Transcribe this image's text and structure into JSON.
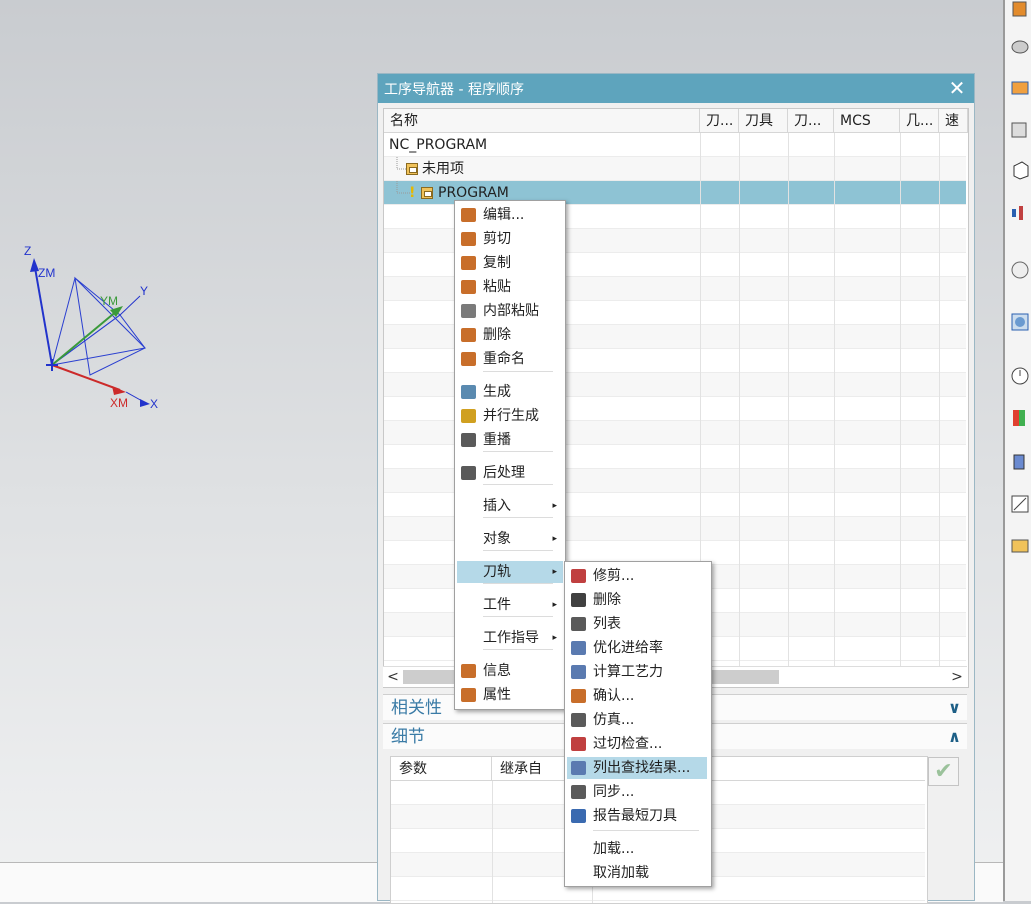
{
  "dialog": {
    "title": "工序导航器 - 程序顺序",
    "close_glyph": "✕"
  },
  "grid": {
    "columns": [
      "名称",
      "刀...",
      "刀具",
      "刀...",
      "MCS",
      "几...",
      "速"
    ],
    "nodes": {
      "root": "NC_PROGRAM",
      "unused": "未用项",
      "program": "PROGRAM",
      "warning": "!"
    }
  },
  "scroll": {
    "left": "<",
    "right": ">"
  },
  "sections": {
    "relevance": {
      "label": "相关性",
      "chevron": "∨"
    },
    "details": {
      "label": "细节",
      "chevron": "∧"
    }
  },
  "params": {
    "columns": [
      "参数",
      "继承自"
    ],
    "ok_glyph": "✔"
  },
  "context_menu": {
    "items": [
      {
        "label": "编辑...",
        "icon": "edit-icon",
        "color": "#c86e2a"
      },
      {
        "label": "剪切",
        "icon": "cut-icon",
        "color": "#c86e2a"
      },
      {
        "label": "复制",
        "icon": "copy-icon",
        "color": "#c86e2a"
      },
      {
        "label": "粘贴",
        "icon": "paste-icon",
        "color": "#c86e2a"
      },
      {
        "label": "内部粘贴",
        "icon": "paste-inside-icon",
        "color": "#7a7a7a"
      },
      {
        "label": "删除",
        "icon": "delete-icon",
        "color": "#c86e2a"
      },
      {
        "label": "重命名",
        "icon": "rename-icon",
        "color": "#c86e2a"
      },
      {
        "label": "生成",
        "icon": "generate-icon",
        "color": "#5a8ab0"
      },
      {
        "label": "并行生成",
        "icon": "parallel-generate-icon",
        "color": "#d0a020"
      },
      {
        "label": "重播",
        "icon": "replay-icon",
        "color": "#5a5a5a"
      },
      {
        "label": "后处理",
        "icon": "postprocess-icon",
        "color": "#5a5a5a"
      },
      {
        "label": "插入",
        "submenu": true
      },
      {
        "label": "对象",
        "submenu": true
      },
      {
        "label": "刀轨",
        "submenu": true
      },
      {
        "label": "工件",
        "submenu": true
      },
      {
        "label": "工作指导",
        "submenu": true
      },
      {
        "label": "信息",
        "icon": "info-icon",
        "color": "#c86e2a"
      },
      {
        "label": "属性",
        "icon": "properties-icon",
        "color": "#c86e2a"
      }
    ],
    "submenu_arrow": "▸"
  },
  "toolpath_submenu": {
    "items": [
      {
        "label": "修剪...",
        "icon": "trim-icon",
        "color": "#c04040"
      },
      {
        "label": "删除",
        "icon": "delete-toolpath-icon",
        "color": "#404040"
      },
      {
        "label": "列表",
        "icon": "list-icon",
        "color": "#5a5a5a"
      },
      {
        "label": "优化进给率",
        "icon": "optimize-feed-icon",
        "color": "#5a7ab0"
      },
      {
        "label": "计算工艺力",
        "icon": "compute-force-icon",
        "color": "#5a7ab0"
      },
      {
        "label": "确认...",
        "icon": "verify-icon",
        "color": "#c86e2a"
      },
      {
        "label": "仿真...",
        "icon": "simulate-icon",
        "color": "#5a5a5a"
      },
      {
        "label": "过切检查...",
        "icon": "gouge-check-icon",
        "color": "#c04040"
      },
      {
        "label": "列出查找结果...",
        "icon": "list-results-icon",
        "color": "#5a7ab0"
      },
      {
        "label": "同步...",
        "icon": "sync-icon",
        "color": "#5a5a5a"
      },
      {
        "label": "报告最短刀具",
        "icon": "shortest-tool-icon",
        "color": "#3a6ab0"
      },
      {
        "label": "加载..."
      },
      {
        "label": "取消加载"
      }
    ]
  },
  "triad": {
    "z": "Z",
    "zm": "ZM",
    "y": "Y",
    "ym": "YM",
    "x": "X",
    "xm": "XM",
    "colors": {
      "z": "#2233cc",
      "y": "#3a9a3a",
      "x": "#cc2a2a"
    }
  }
}
